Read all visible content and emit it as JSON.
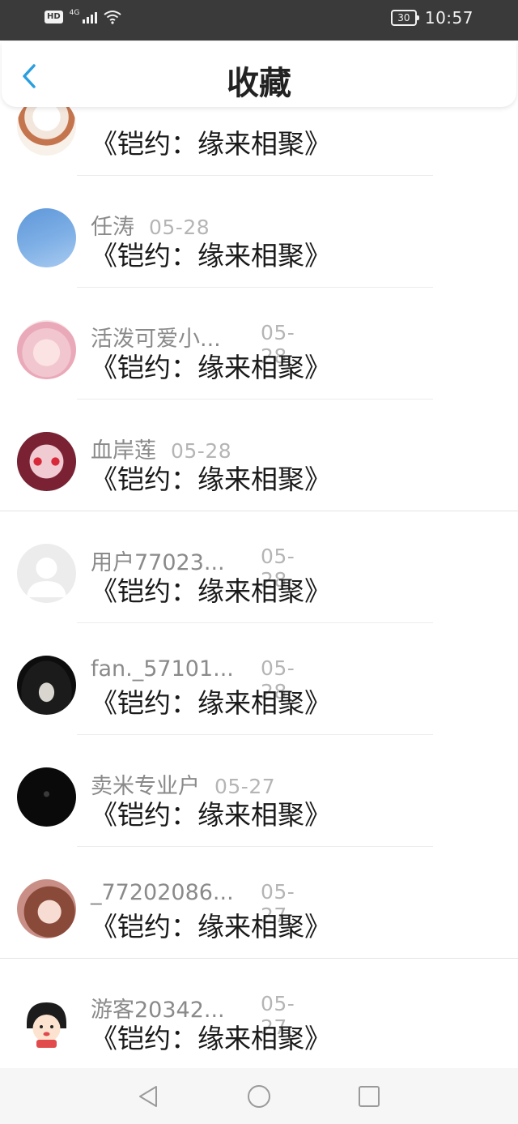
{
  "status_bar": {
    "hd_label": "HD",
    "network_label": "4G",
    "battery_level": "30",
    "time": "10:57"
  },
  "header": {
    "title": "收藏",
    "accent_color": "#2a9fe0"
  },
  "items": [
    {
      "name": "",
      "date": "",
      "book": "《铠约：缘来相聚》",
      "avatar_icon": "anime-girl-avatar"
    },
    {
      "name": "任涛",
      "date": "05-28",
      "book": "《铠约：缘来相聚》",
      "avatar_icon": "blue-sky-avatar"
    },
    {
      "name": "活泼可爱小...",
      "date": "05-28",
      "book": "《铠约：缘来相聚》",
      "avatar_icon": "pink-anime-avatar"
    },
    {
      "name": "血岸莲",
      "date": "05-28",
      "book": "《铠约：缘来相聚》",
      "avatar_icon": "red-eye-avatar"
    },
    {
      "name": "用户77023...",
      "date": "05-28",
      "book": "《铠约：缘来相聚》",
      "avatar_icon": "default-user-avatar"
    },
    {
      "name": "fan._57101...",
      "date": "05-28",
      "book": "《铠约：缘来相聚》",
      "avatar_icon": "masked-person-avatar"
    },
    {
      "name": "卖米专业户",
      "date": "05-27",
      "book": "《铠约：缘来相聚》",
      "avatar_icon": "black-avatar"
    },
    {
      "name": "_77202086...",
      "date": "05-27",
      "book": "《铠约：缘来相聚》",
      "avatar_icon": "brown-hair-anime-avatar"
    },
    {
      "name": "游客20342...",
      "date": "05-27",
      "book": "《铠约：缘来相聚》",
      "avatar_icon": "cartoon-kid-avatar"
    }
  ],
  "nav_bar": {
    "back_icon": "triangle-back-icon",
    "home_icon": "circle-home-icon",
    "recent_icon": "square-recent-icon"
  }
}
